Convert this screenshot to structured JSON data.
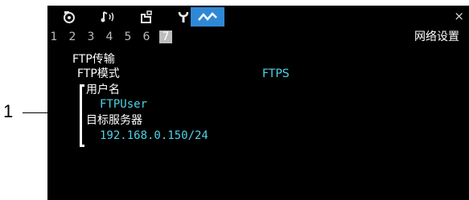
{
  "callout": {
    "number": "1"
  },
  "tabs": [
    {
      "name": "camera-tab-icon",
      "glyph": "◔"
    },
    {
      "name": "audio-tab-icon",
      "glyph": "♪)"
    },
    {
      "name": "card-tab-icon",
      "glyph": "⎔"
    },
    {
      "name": "wrench-tab-icon",
      "glyph": "Y"
    },
    {
      "name": "network-tab-icon",
      "glyph": "~",
      "active": true
    }
  ],
  "close_label": "×",
  "pages": [
    "1",
    "2",
    "3",
    "4",
    "5",
    "6",
    "7"
  ],
  "active_page": "7",
  "page_title": "网络设置",
  "ftp": {
    "section_label": "FTP传输",
    "mode_label": "FTP模式",
    "mode_value": "FTPS",
    "username_label": "用户名",
    "username_value": "FTPUser",
    "server_label": "目标服务器",
    "server_value": "192.168.0.150/24"
  },
  "colors": {
    "accent_tab": "#2f88d6",
    "value_cyan": "#4fd2e6"
  }
}
